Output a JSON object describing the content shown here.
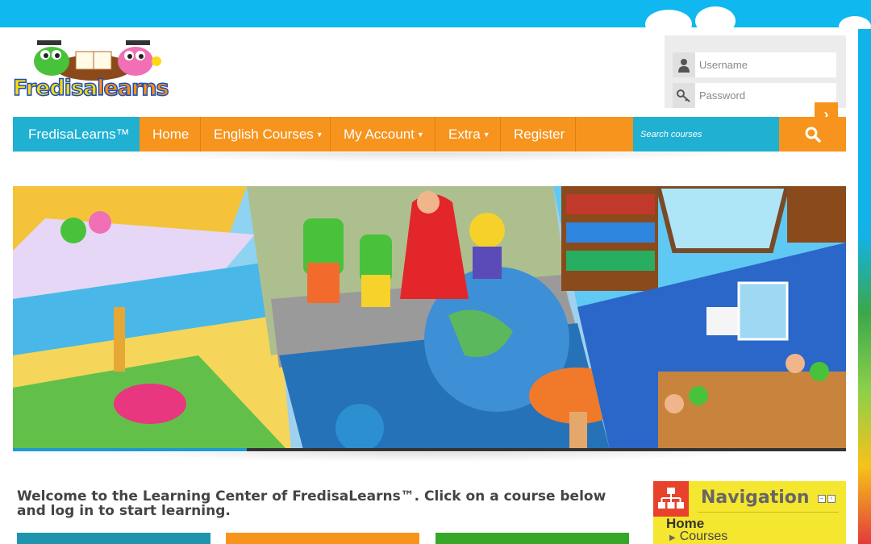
{
  "login": {
    "username_placeholder": "Username",
    "password_placeholder": "Password"
  },
  "navbar": {
    "brand": "FredisaLearns™",
    "items": [
      {
        "label": "Home"
      },
      {
        "label": "English Courses"
      },
      {
        "label": "My Account"
      },
      {
        "label": "Extra"
      },
      {
        "label": "Register"
      }
    ],
    "search_placeholder": "Search courses"
  },
  "main": {
    "welcome": "Welcome to the Learning Center of FredisaLearns™. Click on a course below and log in to start learning."
  },
  "navigation_block": {
    "title": "Navigation",
    "home": "Home",
    "courses": "Courses"
  },
  "logo": {
    "text_part1": "Fredisa",
    "text_part2": "learns"
  },
  "colors": {
    "sky": "#0fb8ef",
    "accent_orange": "#f7941d",
    "accent_teal": "#1fb0d2",
    "accent_green": "#35a829",
    "nav_yellow": "#f5e62f"
  },
  "icons": [
    "user-icon",
    "key-icon",
    "arrow-right-icon",
    "search-icon",
    "sitemap-icon",
    "caret-down-icon"
  ]
}
